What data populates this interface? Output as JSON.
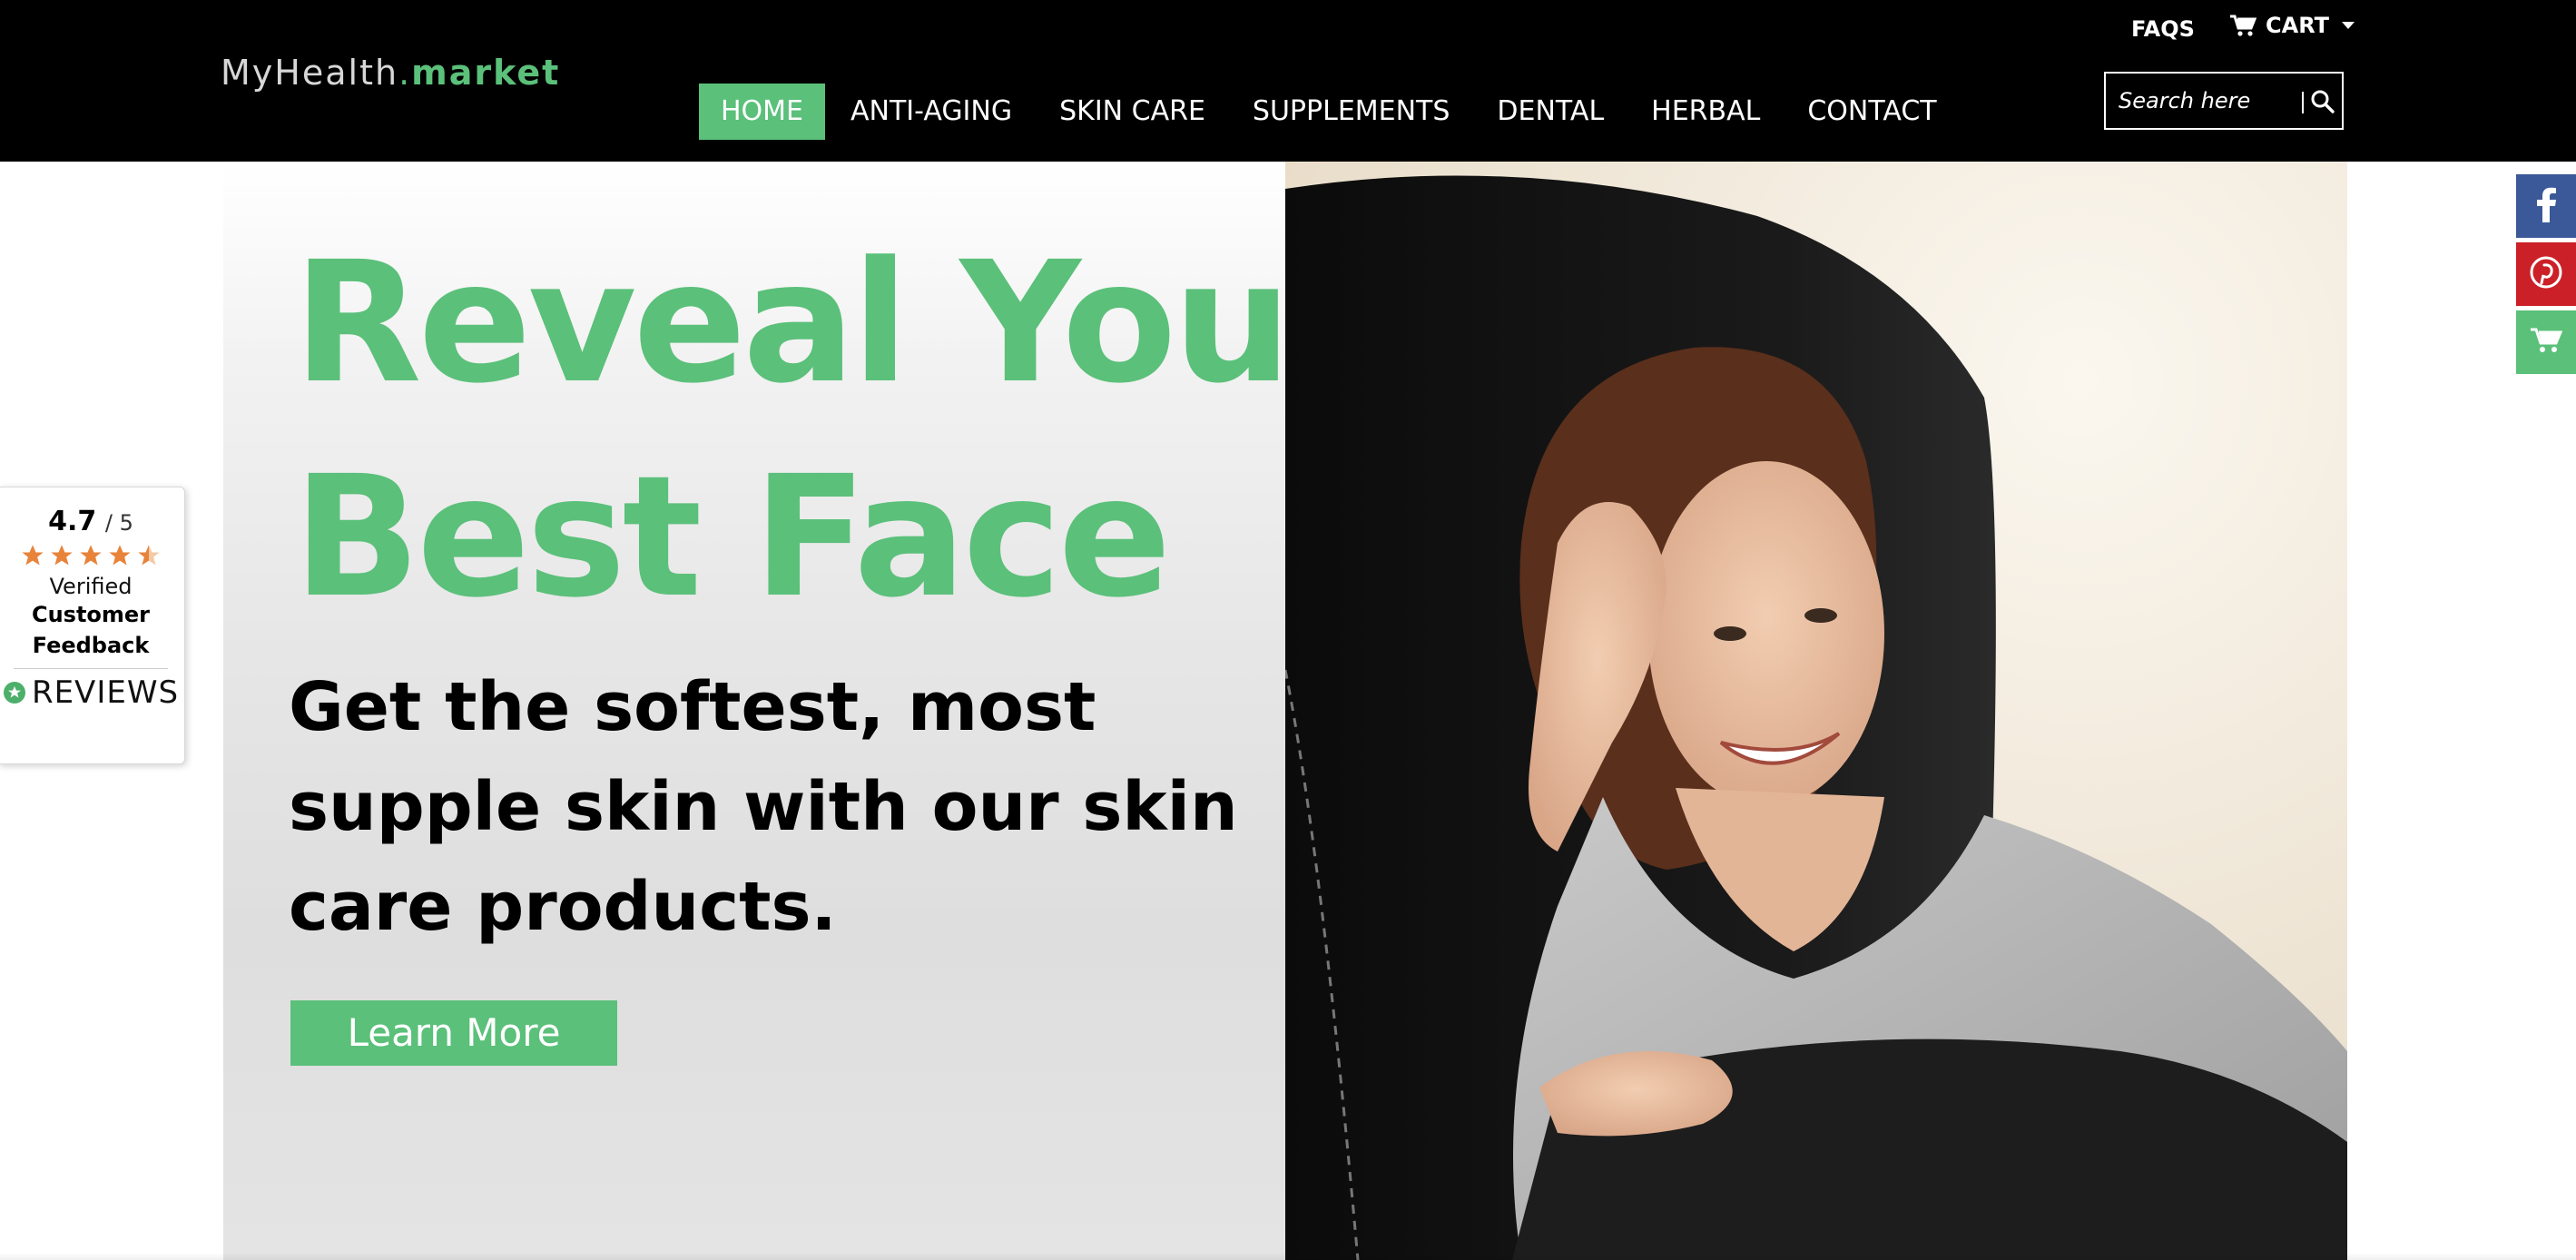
{
  "logo": {
    "brand": "MyHealth",
    "dot": ".",
    "tld": "market"
  },
  "top_links": {
    "faqs": "FAQS",
    "cart": "CART"
  },
  "nav": {
    "items": [
      {
        "label": "HOME",
        "active": true
      },
      {
        "label": "ANTI-AGING"
      },
      {
        "label": "SKIN CARE"
      },
      {
        "label": "SUPPLEMENTS"
      },
      {
        "label": "DENTAL"
      },
      {
        "label": "HERBAL"
      },
      {
        "label": "CONTACT"
      }
    ]
  },
  "search": {
    "placeholder": "Search here",
    "icon": "search-icon"
  },
  "hero": {
    "headline_line1": "Reveal Your",
    "headline_line2": "Best Face",
    "subheadline": "Get the softest, most supple skin with our skin care products.",
    "cta": "Learn More",
    "accent_color": "#5bc07a"
  },
  "social": {
    "items": [
      {
        "icon": "facebook-icon",
        "color": "#3b5998"
      },
      {
        "icon": "pinterest-icon",
        "color": "#cb2027"
      },
      {
        "icon": "shopping-cart-icon",
        "color": "#5bc07a"
      }
    ]
  },
  "reviews_badge": {
    "rating": "4.7",
    "out_of": "/ 5",
    "stars": 4.5,
    "line1": "Verified",
    "line2": "Customer",
    "line3": "Feedback",
    "brand": "REVIEWS"
  }
}
